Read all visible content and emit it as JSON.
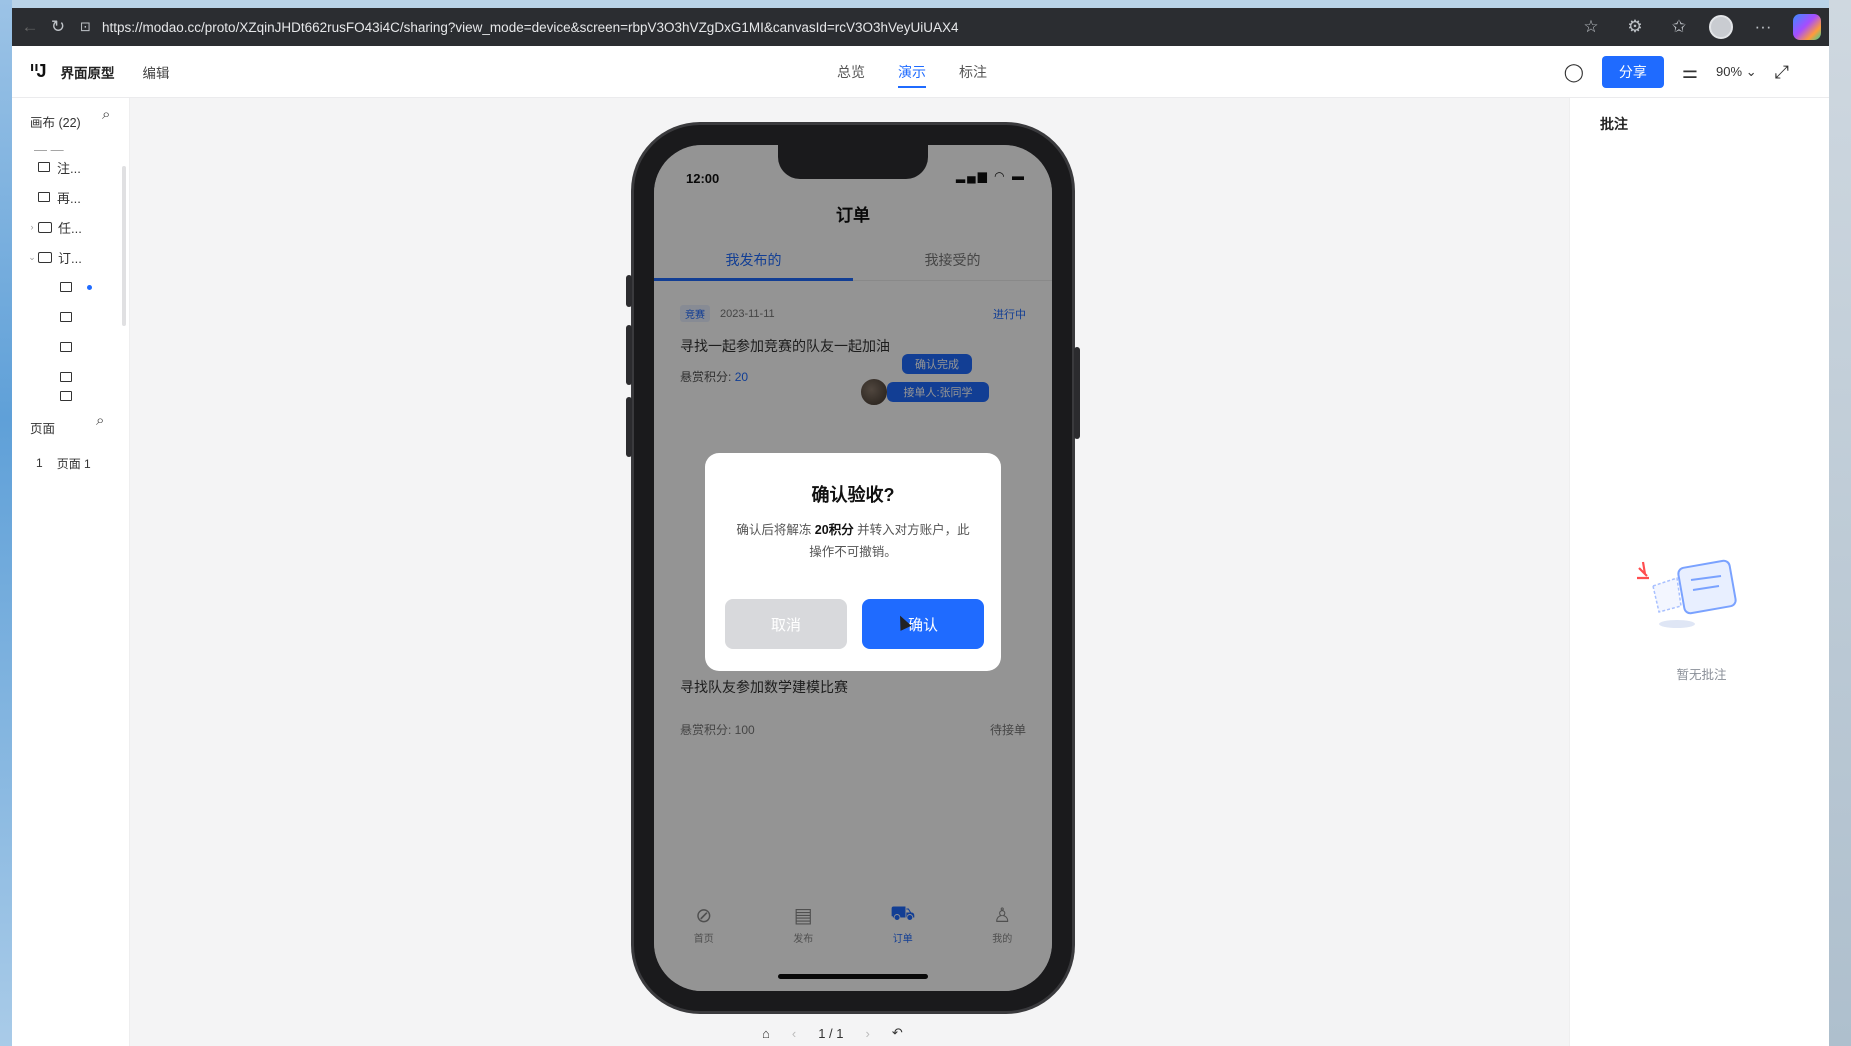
{
  "browser": {
    "url": "https://modao.cc/proto/XZqinJHDt662rusFO43i4C/sharing?view_mode=device&screen=rbpV3O3hVZgDxG1MI&canvasId=rcV3O3hVeyUiUAX4",
    "back_icon": "back-arrow-icon",
    "reload_icon": "reload-icon"
  },
  "app_header": {
    "logo": "ᐦJ",
    "project_title": "界面原型",
    "edit_label": "编辑",
    "tabs": [
      {
        "label": "总览"
      },
      {
        "label": "演示"
      },
      {
        "label": "标注"
      }
    ],
    "share_label": "分享",
    "zoom": "90%"
  },
  "sidebar": {
    "canvas_header": "画布 (22)",
    "items": [
      {
        "label": "注..."
      },
      {
        "label": "再..."
      },
      {
        "label": "任..."
      },
      {
        "label": "订..."
      }
    ],
    "pages_header": "页面",
    "page_index": "1",
    "page_name": "页面 1"
  },
  "right_panel": {
    "title": "批注",
    "empty_text": "暂无批注"
  },
  "phone": {
    "time": "12:00",
    "page_title": "订单",
    "tabs": [
      {
        "label": "我发布的"
      },
      {
        "label": "我接受的"
      }
    ],
    "card1": {
      "tag": "竞赛",
      "date": "2023-11-11",
      "status": "进行中",
      "desc": "寻找一起参加竞赛的队友一起加油",
      "bounty_prefix": "悬赏积分:",
      "bounty_value": "20",
      "confirm_btn": "确认完成",
      "receiver_btn": "接单人:张同学"
    },
    "card2": {
      "title": "寻找队友参加数学建模比赛",
      "bounty": "悬赏积分: 100",
      "status": "待接单"
    },
    "tabbar": [
      {
        "label": "首页",
        "icon": "compass-icon"
      },
      {
        "label": "发布",
        "icon": "document-icon"
      },
      {
        "label": "订单",
        "icon": "cart-icon"
      },
      {
        "label": "我的",
        "icon": "user-icon"
      }
    ],
    "dialog": {
      "title": "确认验收?",
      "body_prefix": "确认后将解冻 ",
      "body_bold": "20积分",
      "body_suffix": " 并转入对方账户，此操作不可撤销。",
      "cancel": "取消",
      "confirm": "确认"
    }
  },
  "pager": {
    "page": "1 / 1"
  },
  "colors": {
    "accent": "#1f6bff",
    "overlay": "rgba(0,0,0,0.42)"
  }
}
